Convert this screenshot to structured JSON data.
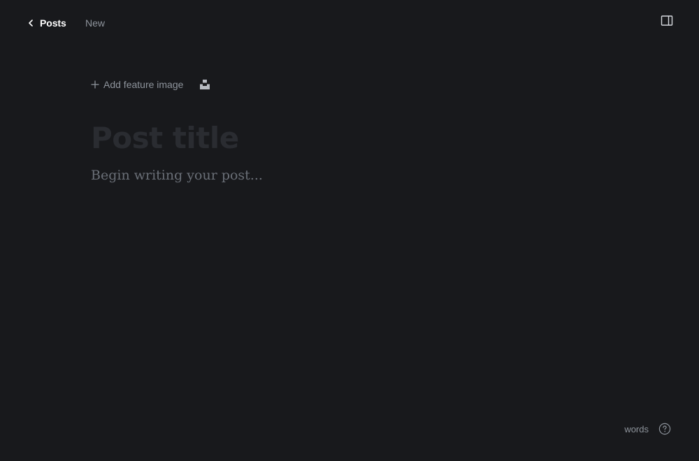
{
  "header": {
    "back_label": "Posts",
    "status": "New"
  },
  "editor": {
    "add_feature_image_label": "Add feature image",
    "title_placeholder": "Post title",
    "body_placeholder": "Begin writing your post..."
  },
  "footer": {
    "word_count_label": "words"
  },
  "icons": {
    "back": "chevron-left-icon",
    "sidebar_toggle": "sidebar-toggle-icon",
    "add": "plus-icon",
    "unsplash": "unsplash-icon",
    "help": "question-mark-circle-icon"
  },
  "colors": {
    "background": "#18191c",
    "muted_text": "#8e949c",
    "title_placeholder": "#2a2c31",
    "body_placeholder": "#6a6f77"
  }
}
